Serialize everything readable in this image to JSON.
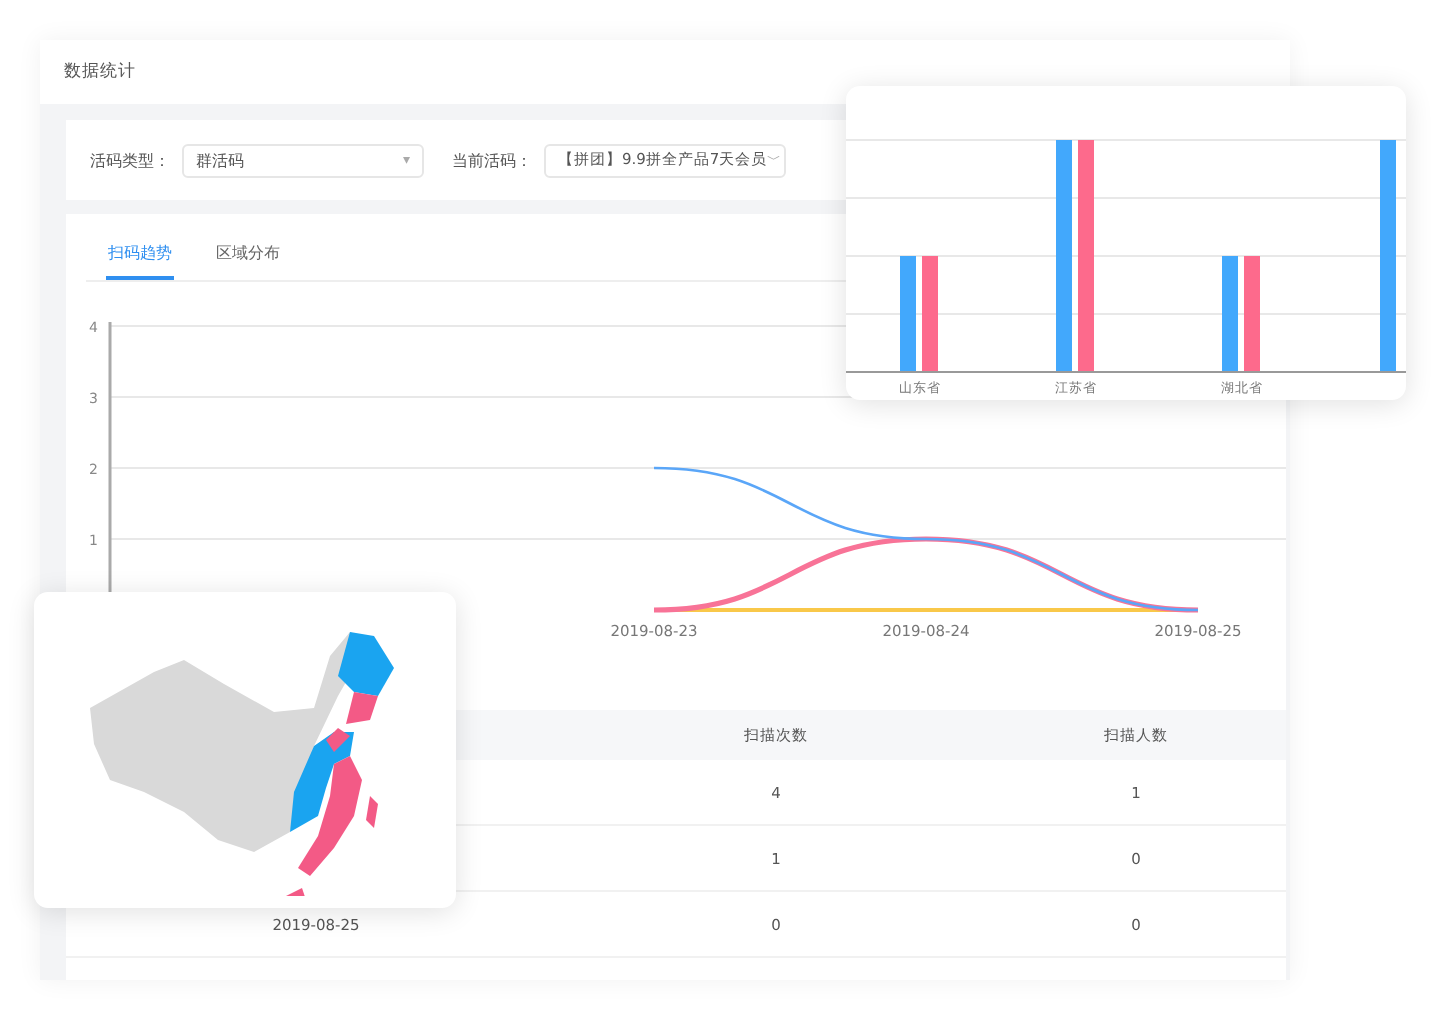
{
  "page_title": "数据统计",
  "filters": [
    {
      "label": "活码类型：",
      "value": "群活码",
      "caret": "▾"
    },
    {
      "label": "当前活码：",
      "value": "【拼团】9.9拼全产品7天会员",
      "caret": "﹀"
    }
  ],
  "tabs": [
    {
      "label": "扫码趋势",
      "selected": true
    },
    {
      "label": "区域分布",
      "selected": false
    }
  ],
  "trend": {
    "chart_data": {
      "type": "line",
      "grid": true,
      "categories": [
        null,
        null,
        "2019-08-23",
        "2019-08-24",
        "2019-08-25"
      ],
      "yticks": [
        1,
        2,
        3,
        4
      ],
      "ylim": [
        0,
        4
      ],
      "series": [
        {
          "color": "#5aa6f8",
          "values": [
            null,
            null,
            2,
            1,
            0
          ]
        },
        {
          "color": "#f87397",
          "values": [
            null,
            null,
            0,
            1,
            0
          ]
        },
        {
          "color": "#f9c84a",
          "values": [
            null,
            null,
            0,
            0,
            0
          ]
        }
      ]
    }
  },
  "table": {
    "columns": [
      "扫描次数",
      "扫描人数"
    ],
    "rows": [
      {
        "cells": [
          "4",
          "1"
        ]
      },
      {
        "cells": [
          "1",
          "0"
        ]
      },
      {
        "date": "2019-08-25",
        "cells": [
          "0",
          "0"
        ]
      }
    ]
  },
  "region_card": {
    "categories": [
      "山东省",
      "江苏省",
      "湖北省"
    ]
  }
}
